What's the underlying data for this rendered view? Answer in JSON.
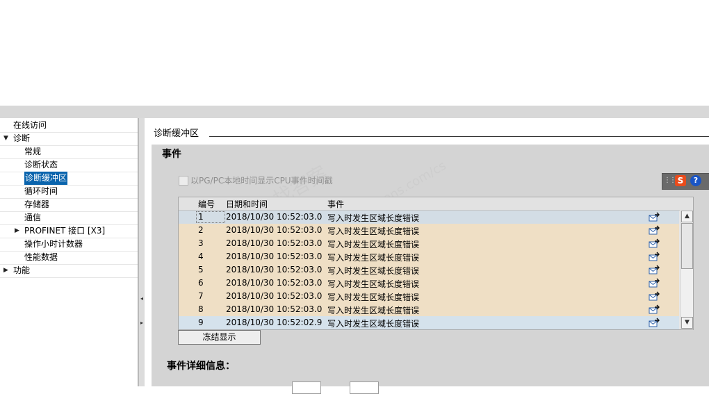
{
  "nav": {
    "items": [
      {
        "label": "在线访问",
        "level": 0
      },
      {
        "label": "诊断",
        "level": 0,
        "expander": "expanded"
      },
      {
        "label": "常规",
        "level": 1
      },
      {
        "label": "诊断状态",
        "level": 1
      },
      {
        "label": "诊断缓冲区",
        "level": 1,
        "selected": true
      },
      {
        "label": "循环时间",
        "level": 1
      },
      {
        "label": "存储器",
        "level": 1
      },
      {
        "label": "通信",
        "level": 1
      },
      {
        "label": "PROFINET 接口 [X3]",
        "level": 1,
        "expander": "collapsed"
      },
      {
        "label": "操作小时计数器",
        "level": 1
      },
      {
        "label": "性能数据",
        "level": 1
      },
      {
        "label": "功能",
        "level": 0,
        "expander": "collapsed"
      }
    ]
  },
  "section": {
    "title": "诊断缓冲区"
  },
  "events": {
    "heading": "事件",
    "checkbox_label": "以PG/PC本地时间显示CPU事件时间戳",
    "checkbox_checked": false,
    "columns": {
      "num": "编号",
      "date": "日期和时间",
      "event": "事件"
    },
    "rows": [
      {
        "num": "1",
        "date": "2018/10/30 10:52:03.0...",
        "event": "写入时发生区域长度错误"
      },
      {
        "num": "2",
        "date": "2018/10/30 10:52:03.0...",
        "event": "写入时发生区域长度错误"
      },
      {
        "num": "3",
        "date": "2018/10/30 10:52:03.0...",
        "event": "写入时发生区域长度错误"
      },
      {
        "num": "4",
        "date": "2018/10/30 10:52:03.0...",
        "event": "写入时发生区域长度错误"
      },
      {
        "num": "5",
        "date": "2018/10/30 10:52:03.0...",
        "event": "写入时发生区域长度错误"
      },
      {
        "num": "6",
        "date": "2018/10/30 10:52:03.0...",
        "event": "写入时发生区域长度错误"
      },
      {
        "num": "7",
        "date": "2018/10/30 10:52:03.0...",
        "event": "写入时发生区域长度错误"
      },
      {
        "num": "8",
        "date": "2018/10/30 10:52:03.0...",
        "event": "写入时发生区域长度错误"
      },
      {
        "num": "9",
        "date": "2018/10/30 10:52:02.9...",
        "event": "写入时发生区域长度错误"
      }
    ],
    "freeze_button": "冻结显示"
  },
  "details": {
    "heading": "事件详细信息："
  },
  "toolbar": {
    "sogou_glyph": "S",
    "help_glyph": "?"
  },
  "watermark": {
    "text1": "找答案",
    "text2": "siemens.com/cs",
    "text3": "工业"
  },
  "colors": {
    "row_bg": "#efdfc5",
    "selected_nav": "#0a64ad",
    "selected_row": "#d3dde5"
  }
}
